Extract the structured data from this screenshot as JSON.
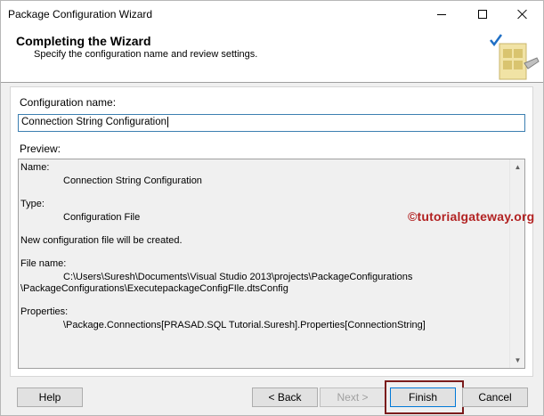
{
  "window": {
    "title": "Package Configuration Wizard"
  },
  "header": {
    "title": "Completing the Wizard",
    "subtitle": "Specify the configuration name and review settings."
  },
  "form": {
    "config_name_label": "Configuration name:",
    "config_name_value": "Connection String Configuration",
    "preview_label": "Preview:"
  },
  "preview": {
    "name_key": "Name:",
    "name_value": "Connection String Configuration",
    "type_key": "Type:",
    "type_value": "Configuration File",
    "status_line": "New configuration file will be created.",
    "file_key": "File name:",
    "file_line1": "C:\\Users\\Suresh\\Documents\\Visual Studio 2013\\projects\\PackageConfigurations",
    "file_line2": "\\PackageConfigurations\\ExecutepackageConfigFIle.dtsConfig",
    "props_key": "Properties:",
    "props_value": "\\Package.Connections[PRASAD.SQL Tutorial.Suresh].Properties[ConnectionString]"
  },
  "watermark": "©tutorialgateway.org",
  "buttons": {
    "help": "Help",
    "back": "< Back",
    "next": "Next >",
    "finish": "Finish",
    "cancel": "Cancel"
  },
  "colors": {
    "focus_border": "#0078d7",
    "highlight": "#7b1c1c",
    "watermark": "#b22222"
  }
}
